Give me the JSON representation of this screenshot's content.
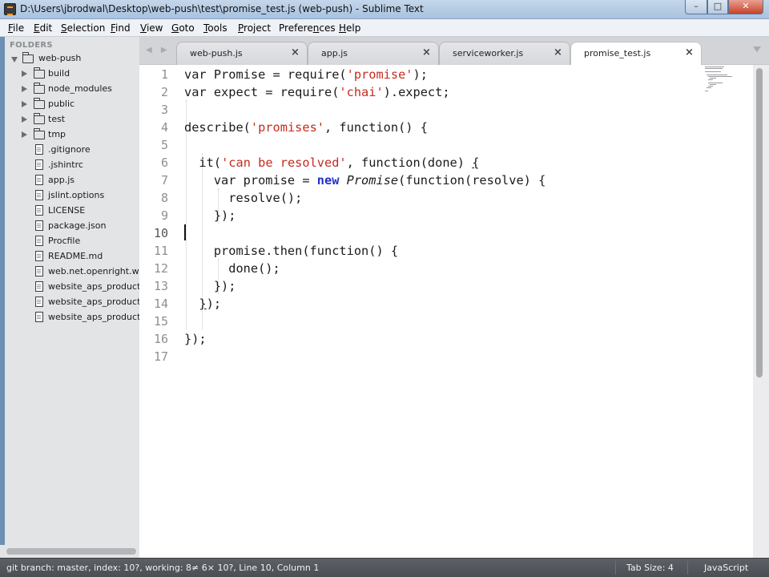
{
  "window": {
    "title": "D:\\Users\\jbrodwal\\Desktop\\web-push\\test\\promise_test.js (web-push) - Sublime Text",
    "minimize_glyph": "–",
    "maximize_glyph": "□",
    "close_glyph": "✕"
  },
  "menu": {
    "items": [
      {
        "label": "File",
        "mnemonic": "F",
        "rest": "ile"
      },
      {
        "label": "Edit",
        "mnemonic": "E",
        "rest": "dit"
      },
      {
        "label": "Selection",
        "mnemonic": "S",
        "rest": "election"
      },
      {
        "label": "Find",
        "mnemonic": "F",
        "rest": "ind",
        "prefix": ""
      },
      {
        "label": "View",
        "mnemonic": "V",
        "rest": "iew"
      },
      {
        "label": "Goto",
        "mnemonic": "G",
        "rest": "oto"
      },
      {
        "label": "Tools",
        "mnemonic": "T",
        "rest": "ools"
      },
      {
        "label": "Project",
        "mnemonic": "P",
        "rest": "roject"
      },
      {
        "label": "Preferences",
        "mnemonic": "n",
        "prefix": "Prefere",
        "rest": "ces"
      },
      {
        "label": "Help",
        "mnemonic": "H",
        "rest": "elp"
      }
    ]
  },
  "sidebar": {
    "header": "FOLDERS",
    "root": "web-push",
    "folders": [
      "build",
      "node_modules",
      "public",
      "test",
      "tmp"
    ],
    "files": [
      ".gitignore",
      ".jshintrc",
      "app.js",
      "jslint.options",
      "LICENSE",
      "package.json",
      "Procfile",
      "README.md",
      "web.net.openright.we",
      "website_aps_productio",
      "website_aps_productio",
      "website_aps_productio"
    ]
  },
  "tabs": [
    {
      "label": "web-push.js",
      "active": false
    },
    {
      "label": "app.js",
      "active": false
    },
    {
      "label": "serviceworker.js",
      "active": false
    },
    {
      "label": "promise_test.js",
      "active": true
    }
  ],
  "tab_close_glyph": "×",
  "editor": {
    "line_numbers": [
      "1",
      "2",
      "3",
      "4",
      "5",
      "6",
      "7",
      "8",
      "9",
      "10",
      "11",
      "12",
      "13",
      "14",
      "15",
      "16",
      "17"
    ],
    "current_line": "10",
    "lines": [
      [
        {
          "t": "var Promise = require("
        },
        {
          "t": "'promise'",
          "c": "str"
        },
        {
          "t": ");"
        }
      ],
      [
        {
          "t": "var expect = require("
        },
        {
          "t": "'chai'",
          "c": "str"
        },
        {
          "t": ").expect;"
        }
      ],
      [],
      [
        {
          "t": "describe("
        },
        {
          "t": "'promises'",
          "c": "str"
        },
        {
          "t": ", function() {"
        }
      ],
      [],
      [
        {
          "t": "  it("
        },
        {
          "t": "'can be resolved'",
          "c": "str"
        },
        {
          "t": ", function(done) "
        },
        {
          "t": "{",
          "c": "u"
        }
      ],
      [
        {
          "t": "    var promise = "
        },
        {
          "t": "new",
          "c": "kw"
        },
        {
          "t": " "
        },
        {
          "t": "Promise",
          "c": "it"
        },
        {
          "t": "(function(resolve) {"
        }
      ],
      [
        {
          "t": "      resolve();"
        }
      ],
      [
        {
          "t": "    });"
        }
      ],
      [],
      [
        {
          "t": "    promise.then(function() {"
        }
      ],
      [
        {
          "t": "      done();"
        }
      ],
      [
        {
          "t": "    });"
        }
      ],
      [
        {
          "t": "  "
        },
        {
          "t": "}",
          "c": "u"
        },
        {
          "t": ");"
        }
      ],
      [],
      [
        {
          "t": "});"
        }
      ],
      []
    ]
  },
  "status": {
    "left": "git branch: master, index: 10?, working: 8≠ 6× 10?, Line 10, Column 1",
    "tab_size": "Tab Size: 4",
    "syntax": "JavaScript"
  }
}
